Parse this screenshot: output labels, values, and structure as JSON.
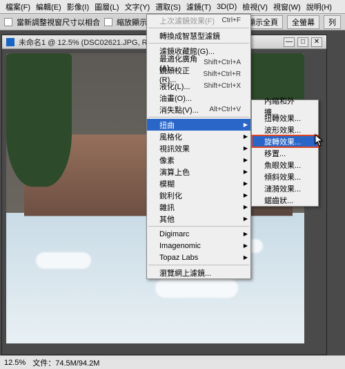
{
  "menubar": {
    "items": [
      "檔案(F)",
      "編輯(E)",
      "影像(I)",
      "圖層(L)",
      "文字(Y)",
      "選取(S)",
      "濾鏡(T)",
      "3D(D)",
      "檢視(V)",
      "視窗(W)",
      "說明(H)"
    ]
  },
  "toolbar": {
    "fit_label": "當新調整視窗尺寸以相合",
    "zoom_label": "縮放顯示",
    "btn_fit": "顯示全頁",
    "btn_fill": "全螢幕",
    "btn_print": "列"
  },
  "document": {
    "title": "未命名1 @ 12.5% (DSC02621.JPG, RGB/8) *"
  },
  "filter_menu": {
    "last": "上次濾鏡效果(F)",
    "last_sc": "Ctrl+F",
    "smart": "轉換成智慧型濾鏡",
    "gallery": "濾鏡收藏館(G)...",
    "adaptive": "最適化廣角(A)...",
    "adaptive_sc": "Shift+Ctrl+A",
    "lens": "鏡頭校正(R)...",
    "lens_sc": "Shift+Ctrl+R",
    "liquify": "液化(L)...",
    "liquify_sc": "Shift+Ctrl+X",
    "oil": "油畫(O)...",
    "vanish": "消失點(V)...",
    "vanish_sc": "Alt+Ctrl+V",
    "distort": "扭曲",
    "stylize": "風格化",
    "video": "視訊效果",
    "pixelate": "像素",
    "render": "演算上色",
    "blur": "模糊",
    "sharpen": "銳利化",
    "noise": "雜訊",
    "other": "其他",
    "digimarc": "Digimarc",
    "imagenomic": "Imagenomic",
    "topaz": "Topaz Labs",
    "browse": "瀏覽網上濾鏡..."
  },
  "distort_submenu": {
    "pinch": "內縮和外擴...",
    "twirl": "扭轉效果...",
    "wave": "波形效果...",
    "spin": "旋轉效果...",
    "displace": "移置...",
    "fisheye": "魚眼效果...",
    "shear": "傾斜效果...",
    "ripple": "漣漪效果...",
    "zigzag": "鋸齒狀..."
  },
  "statusbar": {
    "zoom": "12.5%",
    "doc_label": "文件：",
    "doc_value": "74.5M/94.2M"
  }
}
